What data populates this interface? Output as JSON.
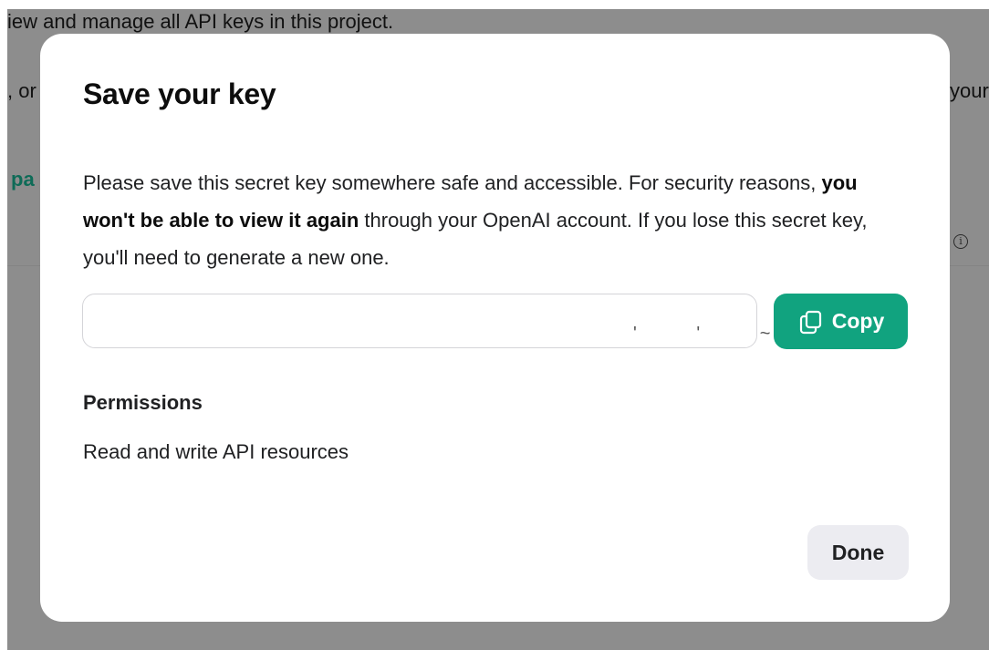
{
  "background": {
    "intro_text": "iew and manage all API keys in this project.",
    "left_fragment": ", or",
    "right_fragment": "your",
    "link_fragment": "pa",
    "info_icon": "info-icon"
  },
  "modal": {
    "title": "Save your key",
    "description_before": "Please save this secret key somewhere safe and accessible. For security reasons, ",
    "description_bold": "you won't be able to view it again",
    "description_after": " through your OpenAI account. If you lose this secret key, you'll need to generate a new one.",
    "key_value": "",
    "key_obscured": "' ' ~",
    "copy_icon": "copy-icon",
    "copy_label": "Copy",
    "permissions_heading": "Permissions",
    "permissions_value": "Read and write API resources",
    "done_label": "Done"
  },
  "colors": {
    "accent": "#11a37f",
    "secondary_button": "#ececf1",
    "overlay": "#8d8d8d",
    "link": "#0e6b57"
  }
}
